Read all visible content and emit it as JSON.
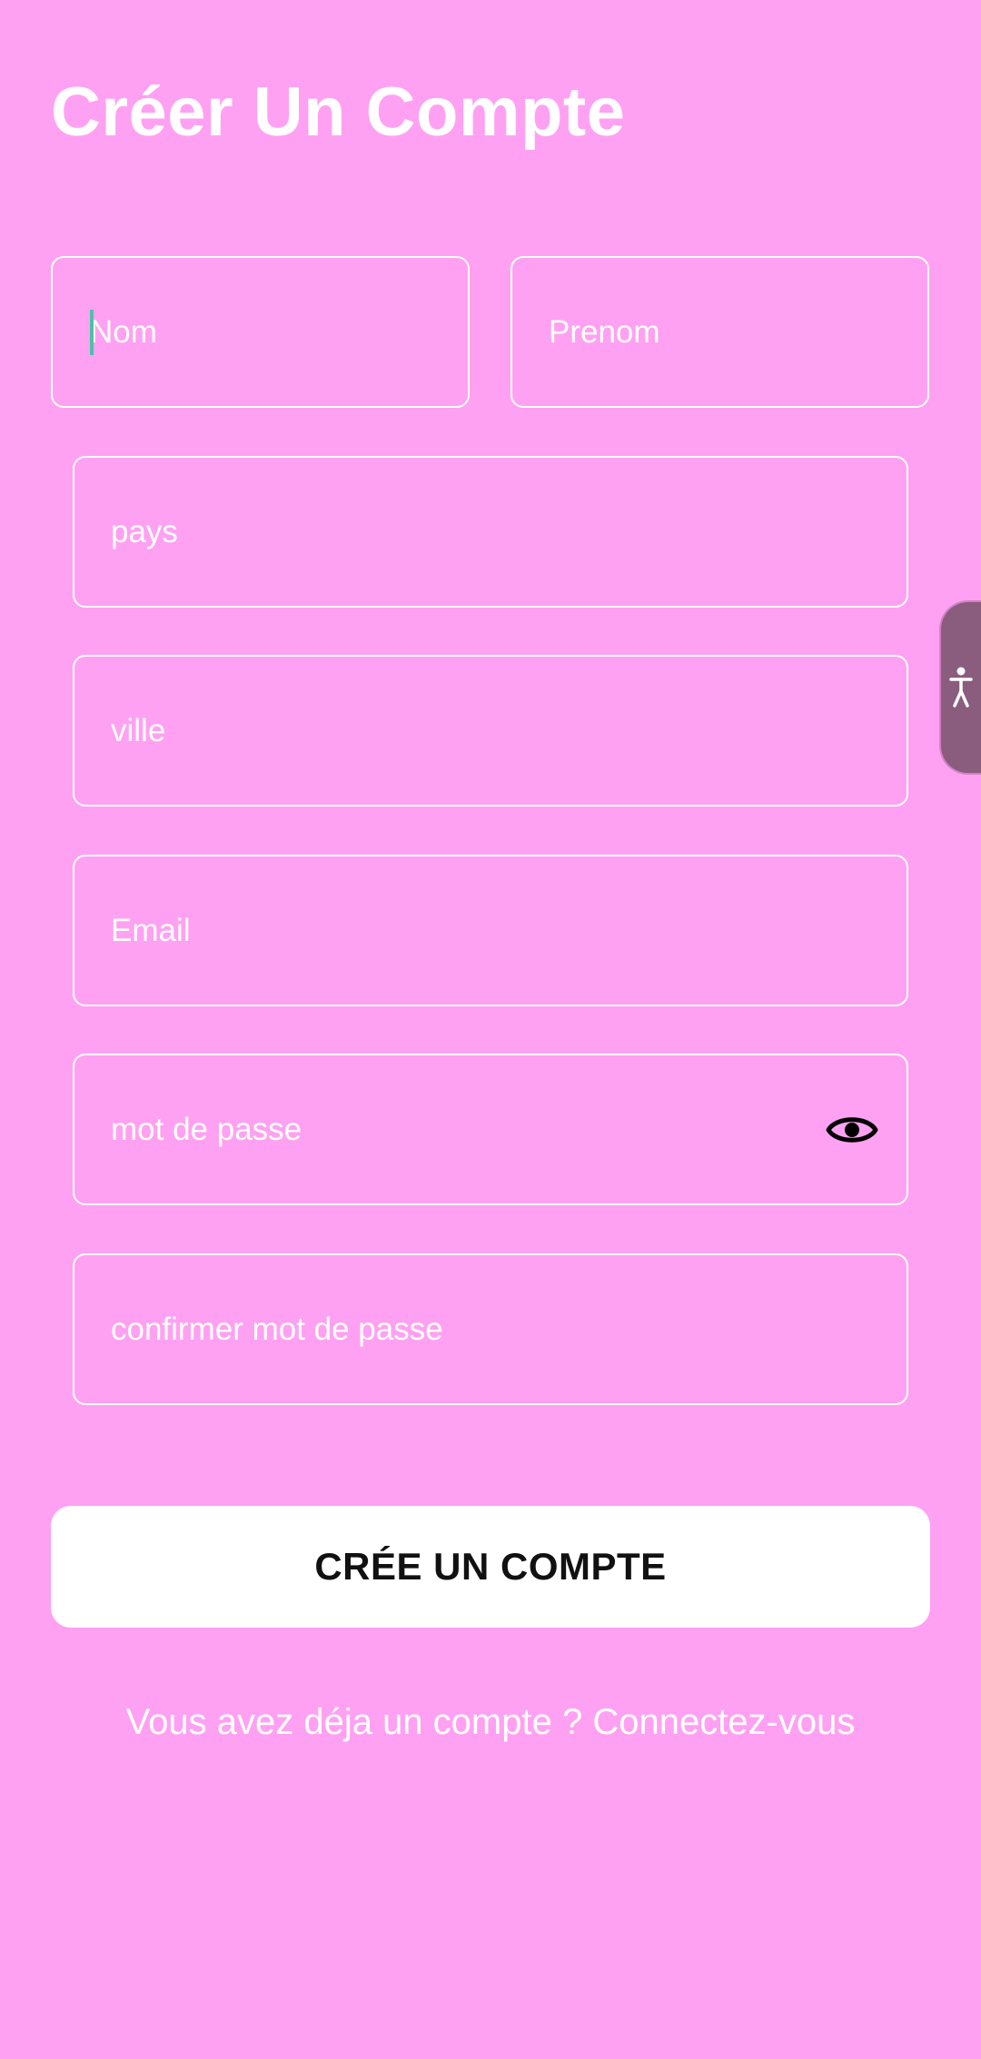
{
  "page": {
    "title": "Créer Un Compte"
  },
  "form": {
    "nom": {
      "placeholder": "Nom",
      "value": ""
    },
    "prenom": {
      "placeholder": "Prenom",
      "value": ""
    },
    "pays": {
      "placeholder": "pays",
      "value": ""
    },
    "ville": {
      "placeholder": "ville",
      "value": ""
    },
    "email": {
      "placeholder": "Email",
      "value": ""
    },
    "password": {
      "placeholder": "mot de passe",
      "value": "",
      "toggle_icon": "eye-icon"
    },
    "confirm_password": {
      "placeholder": "confirmer mot de passe",
      "value": ""
    },
    "submit_label": "CRÉE UN COMPTE"
  },
  "footer": {
    "login_text": "Vous avez déja un compte ? Connectez-vous"
  },
  "accessibility_widget": {
    "icon": "accessibility-person-icon"
  },
  "colors": {
    "background": "#ffa1f2",
    "field_border": "#ffffff",
    "button_background": "#ffffff",
    "button_text": "#111111",
    "accessibility_tab": "#8a5c7e"
  }
}
